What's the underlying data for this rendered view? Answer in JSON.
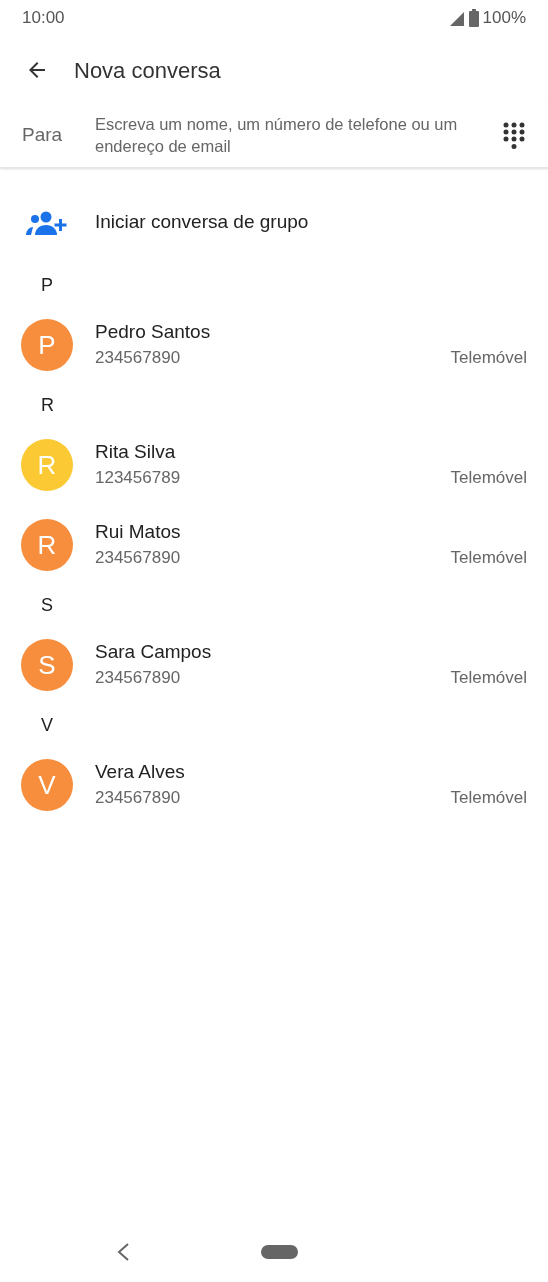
{
  "status_bar": {
    "time": "10:00",
    "battery": "100%"
  },
  "header": {
    "title": "Nova conversa"
  },
  "recipient": {
    "label": "Para",
    "placeholder": "Escreva um nome, um número de telefone ou um endereço de email"
  },
  "group_action": {
    "label": "Iniciar conversa de grupo"
  },
  "sections": [
    {
      "letter": "P",
      "contacts": [
        {
          "initial": "P",
          "name": "Pedro Santos",
          "number": "234567890",
          "type": "Telemóvel",
          "color": "#f68e3d"
        }
      ]
    },
    {
      "letter": "R",
      "contacts": [
        {
          "initial": "R",
          "name": "Rita Silva",
          "number": "123456789",
          "type": "Telemóvel",
          "color": "#fbc933"
        },
        {
          "initial": "R",
          "name": "Rui Matos",
          "number": "234567890",
          "type": "Telemóvel",
          "color": "#f68e3d"
        }
      ]
    },
    {
      "letter": "S",
      "contacts": [
        {
          "initial": "S",
          "name": "Sara Campos",
          "number": "234567890",
          "type": "Telemóvel",
          "color": "#f68e3d"
        }
      ]
    },
    {
      "letter": "V",
      "contacts": [
        {
          "initial": "V",
          "name": "Vera Alves",
          "number": "234567890",
          "type": "Telemóvel",
          "color": "#f68e3d"
        }
      ]
    }
  ]
}
